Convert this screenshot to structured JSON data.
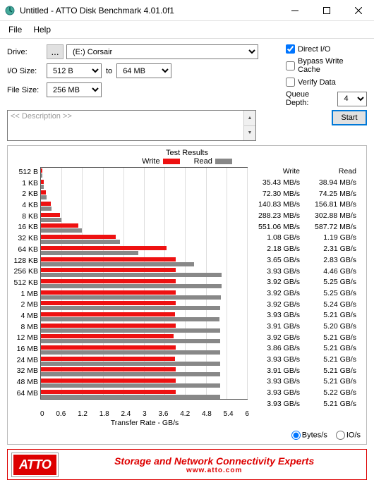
{
  "window": {
    "title": "Untitled - ATTO Disk Benchmark 4.01.0f1"
  },
  "menu": {
    "file": "File",
    "help": "Help"
  },
  "labels": {
    "drive": "Drive:",
    "iosize": "I/O Size:",
    "to": "to",
    "filesize": "File Size:",
    "directio": "Direct I/O",
    "bypass": "Bypass Write Cache",
    "verify": "Verify Data",
    "queuedepth": "Queue Depth:",
    "description_placeholder": "<< Description >>",
    "start": "Start",
    "test_results": "Test Results",
    "write": "Write",
    "read": "Read",
    "xlabel": "Transfer Rate - GB/s",
    "bytes_s": "Bytes/s",
    "io_s": "IO/s"
  },
  "drive": {
    "browse": "...",
    "selected": "(E:) Corsair"
  },
  "iosize": {
    "from": "512 B",
    "to": "64 MB"
  },
  "filesize": {
    "value": "256 MB"
  },
  "options": {
    "directio_checked": true,
    "bypass_checked": false,
    "verify_checked": false,
    "queue_depth": "4"
  },
  "results_display": {
    "mode": "bytes"
  },
  "footer": {
    "logo": "ATTO",
    "tagline": "Storage and Network Connectivity Experts",
    "url": "www.atto.com"
  },
  "chart_data": {
    "type": "bar",
    "xlabel": "Transfer Rate - GB/s",
    "xlim": [
      0,
      6
    ],
    "xticks": [
      0,
      0.6,
      1.2,
      1.8,
      2.4,
      3,
      3.6,
      4.2,
      4.8,
      5.4,
      6
    ],
    "categories": [
      "512 B",
      "1 KB",
      "2 KB",
      "4 KB",
      "8 KB",
      "16 KB",
      "32 KB",
      "64 KB",
      "128 KB",
      "256 KB",
      "512 KB",
      "1 MB",
      "2 MB",
      "4 MB",
      "8 MB",
      "12 MB",
      "16 MB",
      "24 MB",
      "32 MB",
      "48 MB",
      "64 MB"
    ],
    "series": [
      {
        "name": "Write",
        "unit": "GB/s",
        "values": [
          0.03543,
          0.0723,
          0.14083,
          0.28823,
          0.55106,
          1.08,
          2.18,
          3.65,
          3.93,
          3.92,
          3.92,
          3.92,
          3.93,
          3.91,
          3.92,
          3.86,
          3.93,
          3.91,
          3.93,
          3.93,
          3.93
        ],
        "display": [
          "35.43 MB/s",
          "72.30 MB/s",
          "140.83 MB/s",
          "288.23 MB/s",
          "551.06 MB/s",
          "1.08 GB/s",
          "2.18 GB/s",
          "3.65 GB/s",
          "3.93 GB/s",
          "3.92 GB/s",
          "3.92 GB/s",
          "3.92 GB/s",
          "3.93 GB/s",
          "3.91 GB/s",
          "3.92 GB/s",
          "3.86 GB/s",
          "3.93 GB/s",
          "3.91 GB/s",
          "3.93 GB/s",
          "3.93 GB/s",
          "3.93 GB/s"
        ]
      },
      {
        "name": "Read",
        "unit": "GB/s",
        "values": [
          0.03894,
          0.07425,
          0.15681,
          0.30288,
          0.58772,
          1.19,
          2.31,
          2.83,
          4.46,
          5.25,
          5.25,
          5.24,
          5.21,
          5.2,
          5.21,
          5.21,
          5.21,
          5.21,
          5.21,
          5.22,
          5.21
        ],
        "display": [
          "38.94 MB/s",
          "74.25 MB/s",
          "156.81 MB/s",
          "302.88 MB/s",
          "587.72 MB/s",
          "1.19 GB/s",
          "2.31 GB/s",
          "2.83 GB/s",
          "4.46 GB/s",
          "5.25 GB/s",
          "5.25 GB/s",
          "5.24 GB/s",
          "5.21 GB/s",
          "5.20 GB/s",
          "5.21 GB/s",
          "5.21 GB/s",
          "5.21 GB/s",
          "5.21 GB/s",
          "5.21 GB/s",
          "5.22 GB/s",
          "5.21 GB/s"
        ]
      }
    ]
  }
}
